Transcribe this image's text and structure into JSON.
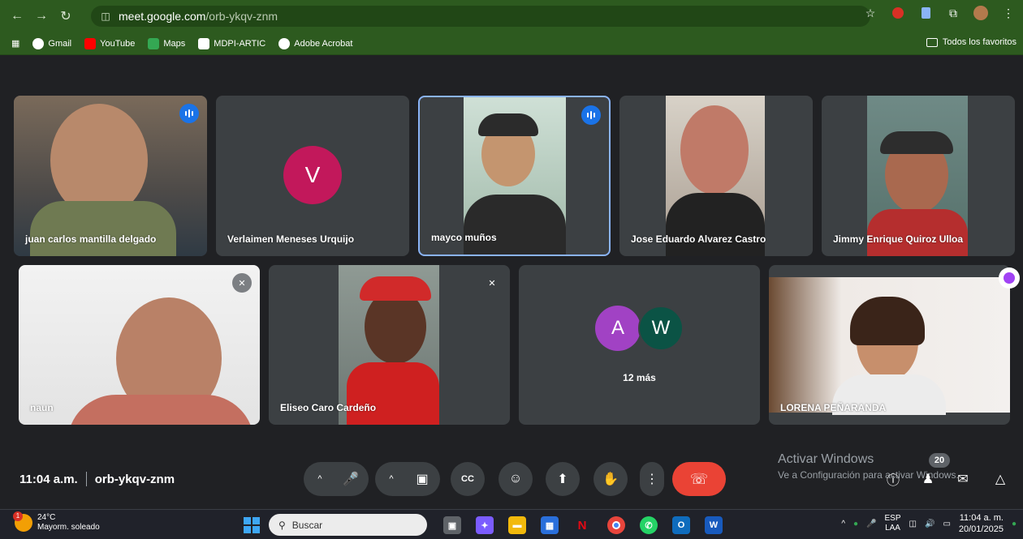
{
  "browser": {
    "url_host": "meet.google.com",
    "url_path": "/orb-ykqv-znm",
    "bookmarks": [
      "Gmail",
      "YouTube",
      "Maps",
      "MDPI-ARTIC",
      "Adobe Acrobat"
    ],
    "favorites_label": "Todos los favoritos",
    "accent_color": "#2d5a1f"
  },
  "participants": {
    "p1": "juan carlos mantilla delgado",
    "p2": "Verlaimen Meneses Urquijo",
    "p2_initial": "V",
    "p3": "mayco muños",
    "p4": "Jose Eduardo Alvarez Castro",
    "p5": "Jimmy Enrique Quiroz Ulloa",
    "p6": "naun",
    "p7": "Eliseo Caro Cardeño",
    "p8_initial_a": "A",
    "p8_initial_w": "W",
    "p8_more": "12 más",
    "p9": "LORENA PEÑARANDA"
  },
  "meeting": {
    "time": "11:04 a.m.",
    "code": "orb-ykqv-znm",
    "participant_count": "20"
  },
  "watermark": {
    "line1": "Activar Windows",
    "line2": "Ve a Configuración para activar Windows."
  },
  "taskbar": {
    "temperature": "24°C",
    "weather": "Mayorm. soleado",
    "weather_badge": "1",
    "search_placeholder": "Buscar",
    "lang1": "ESP",
    "lang2": "LAA",
    "clock_time": "11:04 a. m.",
    "clock_date": "20/01/2025"
  },
  "colors": {
    "end_call": "#ea4335",
    "speaking": "#1a73e8",
    "avatar_v": "#c2185b",
    "avatar_a": "#a142c4",
    "avatar_w": "#0b5345"
  }
}
